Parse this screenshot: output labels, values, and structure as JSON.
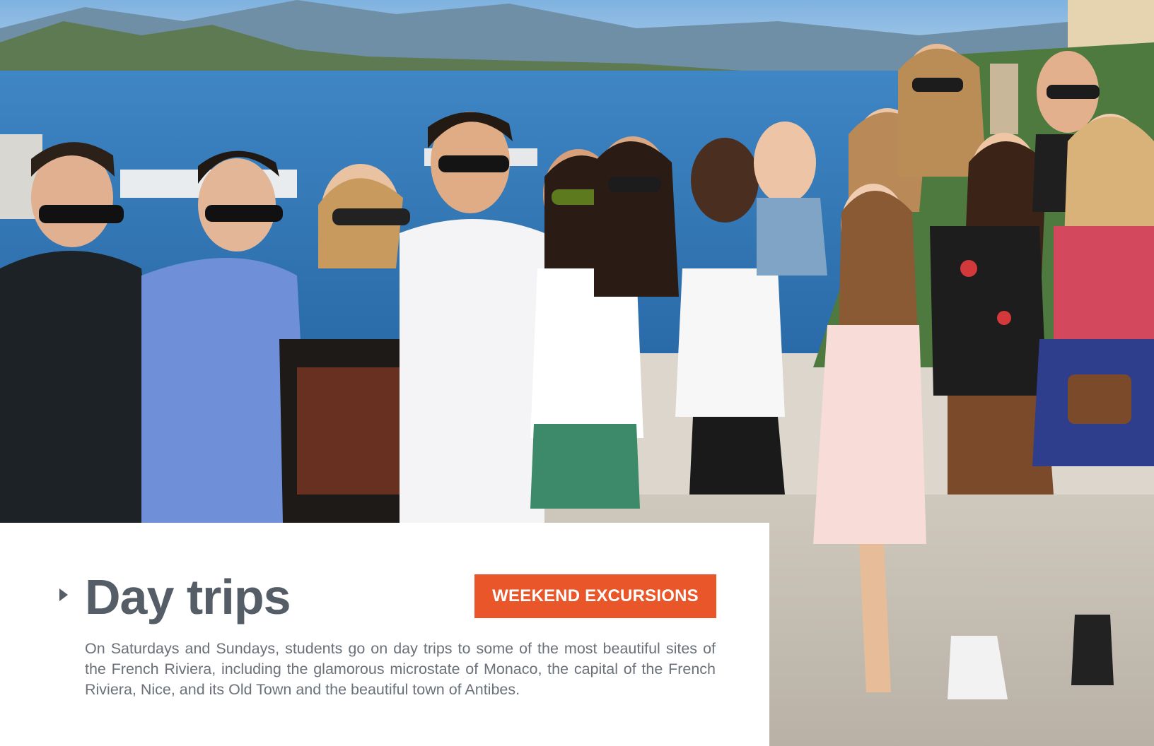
{
  "photo": {
    "description_icon": "group-photo"
  },
  "section": {
    "title": "Day trips",
    "badge": "WEEKEND EXCURSIONS",
    "body": "On Saturdays and Sundays, students go on day trips to some of the most beautiful sites of the French Riviera, including the glamorous microstate of Monaco, the capital of the French Riviera, Nice, and its Old Town and the beautiful town of Antibes."
  },
  "colors": {
    "accent": "#e8562a",
    "title": "#555d66",
    "body_text": "#6b7178",
    "sea": "#3f86c4"
  }
}
